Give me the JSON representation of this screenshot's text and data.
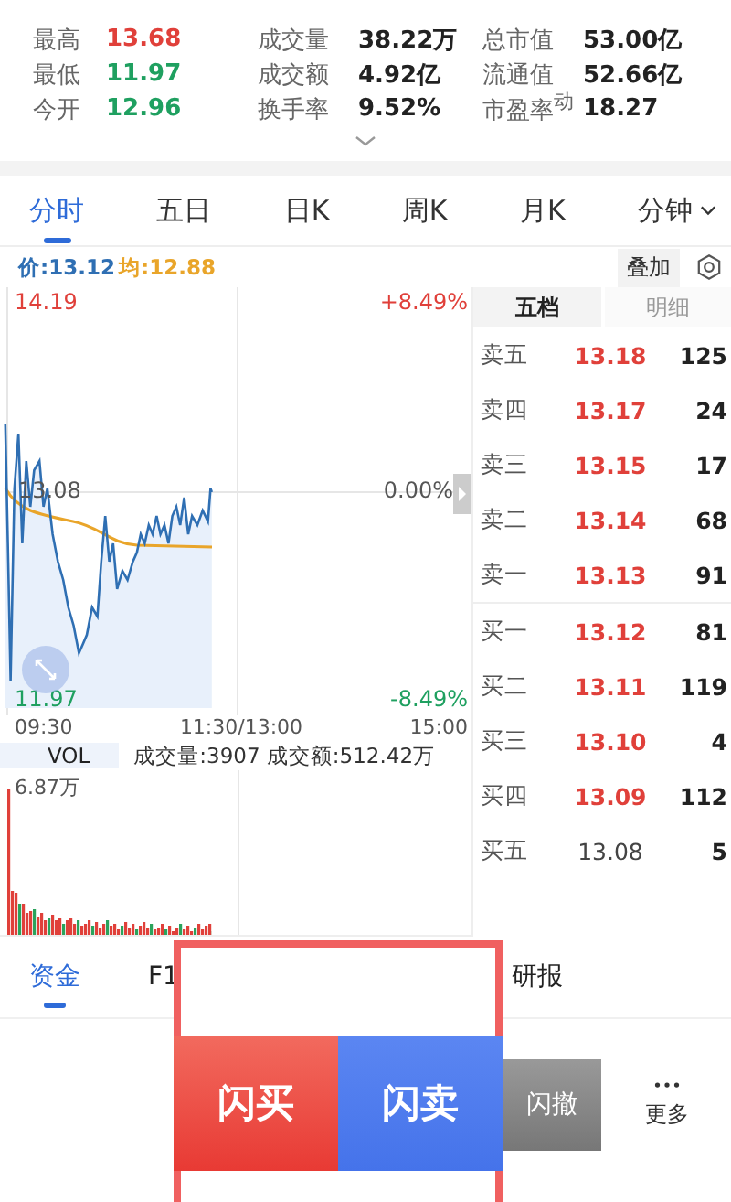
{
  "stat_rows": [
    [
      {
        "label": "最高",
        "value": "13.68",
        "color": "#e0403a"
      },
      {
        "label": "成交量",
        "value": "38.22万",
        "color": "#222222"
      },
      {
        "label": "总市值",
        "value": "53.00亿",
        "color": "#222222"
      }
    ],
    [
      {
        "label": "最低",
        "value": "11.97",
        "color": "#1fa060"
      },
      {
        "label": "成交额",
        "value": "4.92亿",
        "color": "#222222"
      },
      {
        "label": "流通值",
        "value": "52.66亿",
        "color": "#222222"
      }
    ],
    [
      {
        "label": "今开",
        "value": "12.96",
        "color": "#1fa060"
      },
      {
        "label": "换手率",
        "value": "9.52%",
        "color": "#222222"
      },
      {
        "label": "市盈率$^{动}$",
        "value": "18.27",
        "color": "#222222"
      }
    ]
  ],
  "tabs": [
    {
      "label": "分时",
      "selected": true,
      "dropdown": false
    },
    {
      "label": "五日",
      "selected": false,
      "dropdown": false
    },
    {
      "label": "日K",
      "selected": false,
      "dropdown": false
    },
    {
      "label": "周K",
      "selected": false,
      "dropdown": false
    },
    {
      "label": "月K",
      "selected": false,
      "dropdown": false
    },
    {
      "label": "分钟",
      "selected": false,
      "dropdown": true
    }
  ],
  "chart": {
    "price_label": "价:13.12",
    "avg_label": "均:12.88",
    "overlay_button": "叠加",
    "y_max": "14.19",
    "y_mid": "13.08",
    "y_min": "11.97",
    "pct_max": "+8.49%",
    "pct_mid": "0.00%",
    "pct_min": "-8.49%",
    "times": [
      "09:30",
      "11:30/13:00",
      "15:00"
    ]
  },
  "volume": {
    "label": "VOL",
    "summary": "成交量:3907 成交额:512.42万",
    "max": "6.87万"
  },
  "order_book": {
    "tabs": [
      {
        "label": "五档",
        "selected": true
      },
      {
        "label": "明细",
        "selected": false
      }
    ],
    "rows": [
      {
        "label": "卖五",
        "price": "13.18",
        "color": "#e0403a",
        "volume": "125"
      },
      {
        "label": "卖四",
        "price": "13.17",
        "color": "#e0403a",
        "volume": "24"
      },
      {
        "label": "卖三",
        "price": "13.15",
        "color": "#e0403a",
        "volume": "17"
      },
      {
        "label": "卖二",
        "price": "13.14",
        "color": "#e0403a",
        "volume": "68"
      },
      {
        "label": "卖一",
        "price": "13.13",
        "color": "#e0403a",
        "volume": "91"
      },
      {
        "label": "买一",
        "price": "13.12",
        "color": "#e0403a",
        "volume": "81"
      },
      {
        "label": "买二",
        "price": "13.11",
        "color": "#e0403a",
        "volume": "119"
      },
      {
        "label": "买三",
        "price": "13.10",
        "color": "#e0403a",
        "volume": "4"
      },
      {
        "label": "买四",
        "price": "13.09",
        "color": "#e0403a",
        "volume": "112"
      },
      {
        "label": "买五",
        "price": "13.08",
        "color": "#444444",
        "volume": "5"
      }
    ]
  },
  "bottom_tabs": [
    {
      "label": "资金",
      "selected": true
    },
    {
      "label": "F1",
      "selected": false
    },
    {
      "label": "研报",
      "selected": false
    }
  ],
  "trade": {
    "buy": "闪买",
    "sell": "闪卖",
    "cancel": "闪撤",
    "more": "更多"
  }
}
